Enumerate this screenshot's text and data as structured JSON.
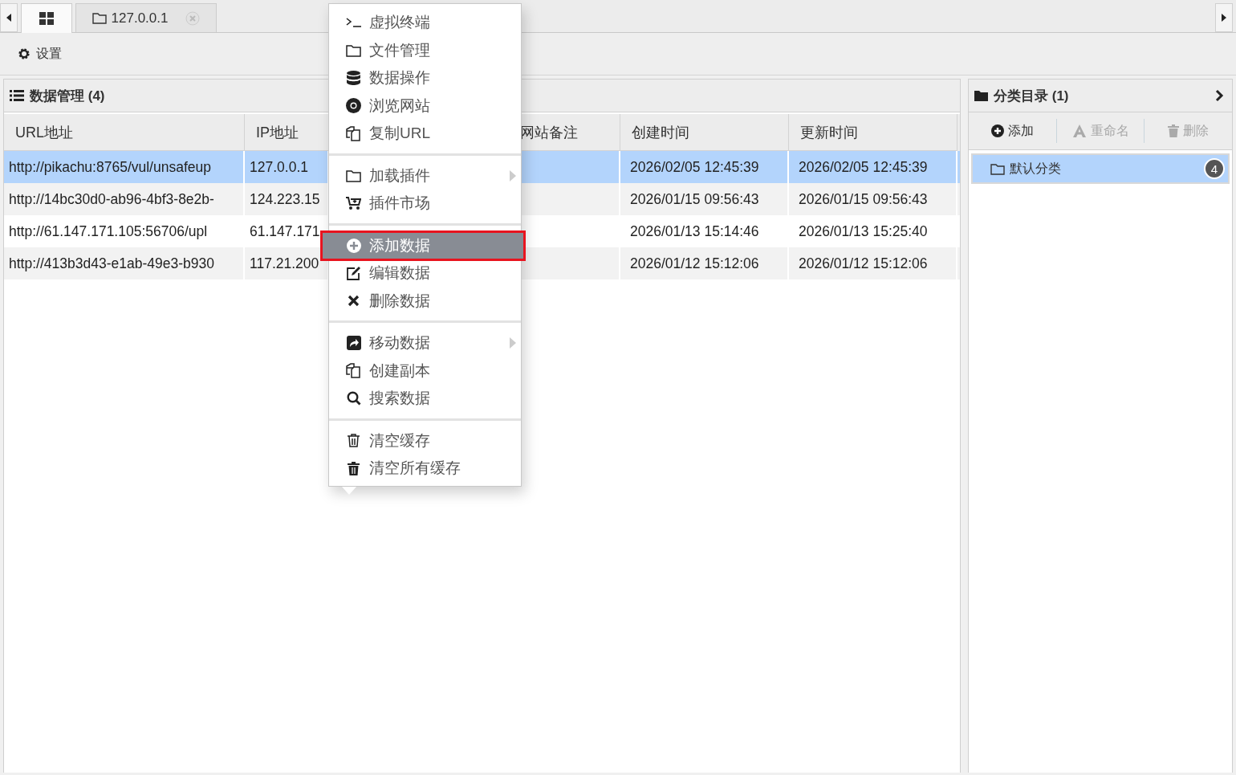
{
  "tabs": [
    {
      "kind": "home",
      "selected": true
    },
    {
      "kind": "host",
      "label": "127.0.0.1",
      "selected": false
    }
  ],
  "toolbar": {
    "settings": "设置"
  },
  "data_panel": {
    "title": "数据管理 (4)",
    "columns": [
      "URL地址",
      "IP地址",
      "",
      "网站备注",
      "创建时间",
      "更新时间"
    ],
    "rows": [
      {
        "selected": true,
        "cells": [
          "http://pikachu:8765/vul/unsafeup",
          "127.0.0.1",
          "",
          "",
          "2026/02/05 12:45:39",
          "2026/02/05 12:45:39"
        ]
      },
      {
        "selected": false,
        "cells": [
          "http://14bc30d0-ab96-4bf3-8e2b-",
          "124.223.15",
          "",
          "",
          "2026/01/15 09:56:43",
          "2026/01/15 09:56:43"
        ]
      },
      {
        "selected": false,
        "cells": [
          "http://61.147.171.105:56706/upl",
          "61.147.171",
          "",
          "",
          "2026/01/13 15:14:46",
          "2026/01/13 15:25:40"
        ]
      },
      {
        "selected": false,
        "cells": [
          "http://413b3d43-e1ab-49e3-b930",
          "117.21.200",
          "",
          "",
          "2026/01/12 15:12:06",
          "2026/01/12 15:12:06"
        ]
      }
    ]
  },
  "category_panel": {
    "title": "分类目录 (1)",
    "actions": [
      {
        "label": "添加",
        "disabled": false
      },
      {
        "label": "重命名",
        "disabled": true
      },
      {
        "label": "删除",
        "disabled": true
      }
    ],
    "items": [
      {
        "label": "默认分类",
        "count": "4",
        "selected": true
      }
    ]
  },
  "context_menu": {
    "items": [
      {
        "kind": "terminal",
        "label": "虚拟终端",
        "selected": false,
        "submenu": false
      },
      {
        "kind": "folder",
        "label": "文件管理",
        "selected": false,
        "submenu": false
      },
      {
        "kind": "database",
        "label": "数据操作",
        "selected": false,
        "submenu": false
      },
      {
        "kind": "browser",
        "label": "浏览网站",
        "selected": false,
        "submenu": false
      },
      {
        "kind": "copy",
        "label": "复制URL",
        "selected": false,
        "submenu": false
      },
      {
        "kind": "separator"
      },
      {
        "kind": "folder",
        "label": "加载插件",
        "selected": false,
        "submenu": true
      },
      {
        "kind": "cart",
        "label": "插件市场",
        "selected": false,
        "submenu": false
      },
      {
        "kind": "separator"
      },
      {
        "kind": "add",
        "label": "添加数据",
        "selected": true,
        "submenu": false
      },
      {
        "kind": "edit",
        "label": "编辑数据",
        "selected": false,
        "submenu": false
      },
      {
        "kind": "delete",
        "label": "删除数据",
        "selected": false,
        "submenu": false
      },
      {
        "kind": "separator"
      },
      {
        "kind": "move",
        "label": "移动数据",
        "selected": false,
        "submenu": true
      },
      {
        "kind": "copy",
        "label": "创建副本",
        "selected": false,
        "submenu": false
      },
      {
        "kind": "search",
        "label": "搜索数据",
        "selected": false,
        "submenu": false
      },
      {
        "kind": "separator"
      },
      {
        "kind": "clear",
        "label": "清空缓存",
        "selected": false,
        "submenu": false
      },
      {
        "kind": "clearall",
        "label": "清空所有缓存",
        "selected": false,
        "submenu": false
      }
    ]
  }
}
